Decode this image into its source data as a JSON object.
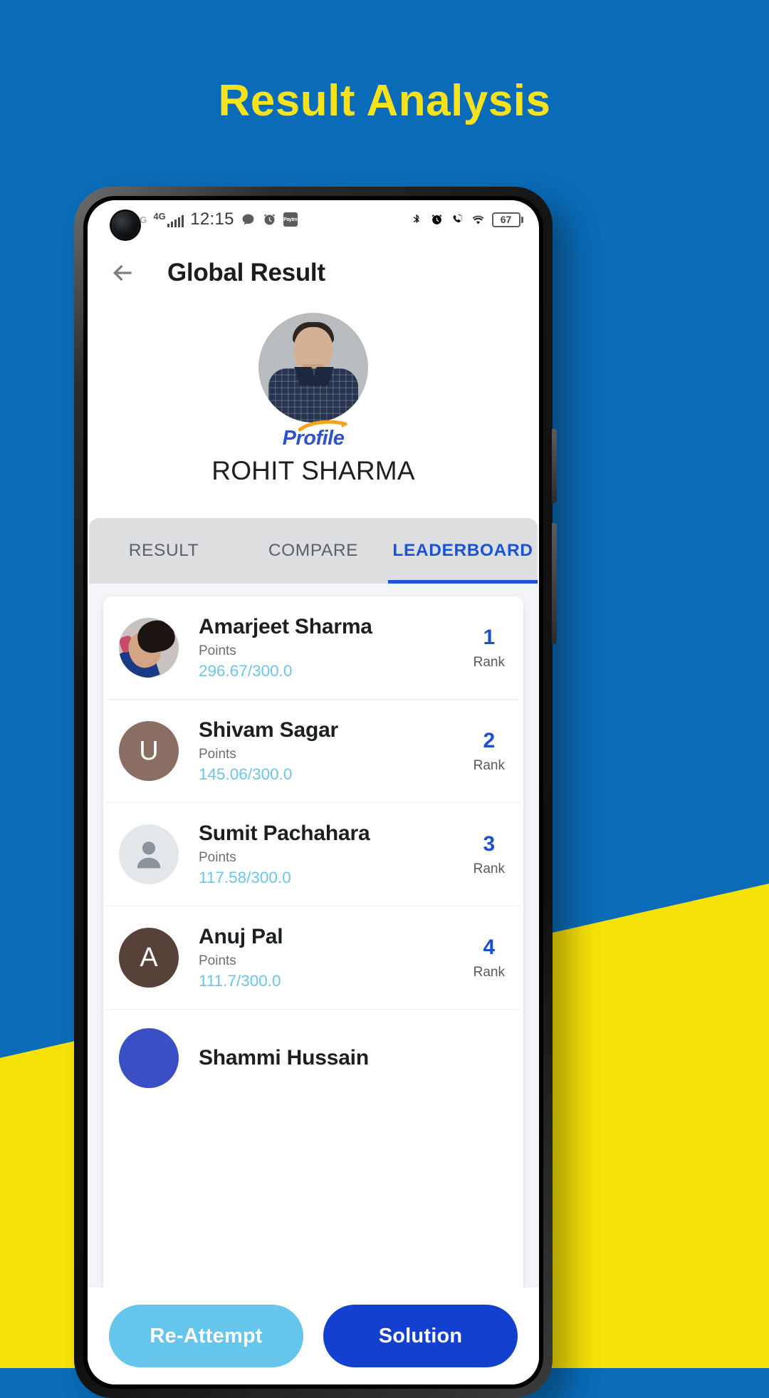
{
  "promo": {
    "headline": "Result Analysis",
    "background_color": "#0a6cb8",
    "accent_color": "#f7e208",
    "headline_color": "#f7e21c"
  },
  "status_bar": {
    "carrier_faded": "4G",
    "network": "4G",
    "time": "12:15",
    "left_icons": [
      "signal-bars-icon",
      "chat-bubble-icon",
      "alarm-clock-icon",
      "paytm-icon"
    ],
    "paytm_label": "Paytm",
    "right_icons": [
      "bluetooth-icon",
      "alarm-clock-icon",
      "dual-sim-call-icon",
      "wifi-icon"
    ],
    "battery_percent": "67"
  },
  "app_bar": {
    "back_icon": "arrow-left-icon",
    "title": "Global Result"
  },
  "profile": {
    "avatar_alt": "profile-photo",
    "logo_text": "Profile",
    "logo_color": "#2f54c9",
    "name": "ROHIT SHARMA"
  },
  "tabs": [
    {
      "label": "RESULT",
      "active": false
    },
    {
      "label": "COMPARE",
      "active": false
    },
    {
      "label": "LEADERBOARD",
      "active": true
    }
  ],
  "tab_active_color": "#1a53d8",
  "leaderboard": {
    "points_label": "Points",
    "rank_label": "Rank",
    "rows": [
      {
        "name": "Amarjeet Sharma",
        "points_label": "Points",
        "points": "296.67/300.0",
        "rank": "1",
        "rank_label": "Rank",
        "avatar_type": "photo",
        "avatar_initial": ""
      },
      {
        "name": "Shivam Sagar",
        "points_label": "Points",
        "points": "145.06/300.0",
        "rank": "2",
        "rank_label": "Rank",
        "avatar_type": "initial",
        "avatar_initial": "U",
        "avatar_color": "#8a6e63"
      },
      {
        "name": "Sumit Pachahara",
        "points_label": "Points",
        "points": "117.58/300.0",
        "rank": "3",
        "rank_label": "Rank",
        "avatar_type": "placeholder",
        "avatar_initial": ""
      },
      {
        "name": "Anuj Pal",
        "points_label": "Points",
        "points": "111.7/300.0",
        "rank": "4",
        "rank_label": "Rank",
        "avatar_type": "initial",
        "avatar_initial": "A",
        "avatar_color": "#574138"
      },
      {
        "name": "Shammi Hussain",
        "points_label": "",
        "points": "",
        "rank": "",
        "rank_label": "",
        "avatar_type": "initial",
        "avatar_initial": "",
        "avatar_color": "#3b4fc4"
      }
    ]
  },
  "bottom_bar": {
    "reattempt_label": "Re-Attempt",
    "reattempt_color": "#65c5ea",
    "solution_label": "Solution",
    "solution_color": "#1440cf"
  }
}
